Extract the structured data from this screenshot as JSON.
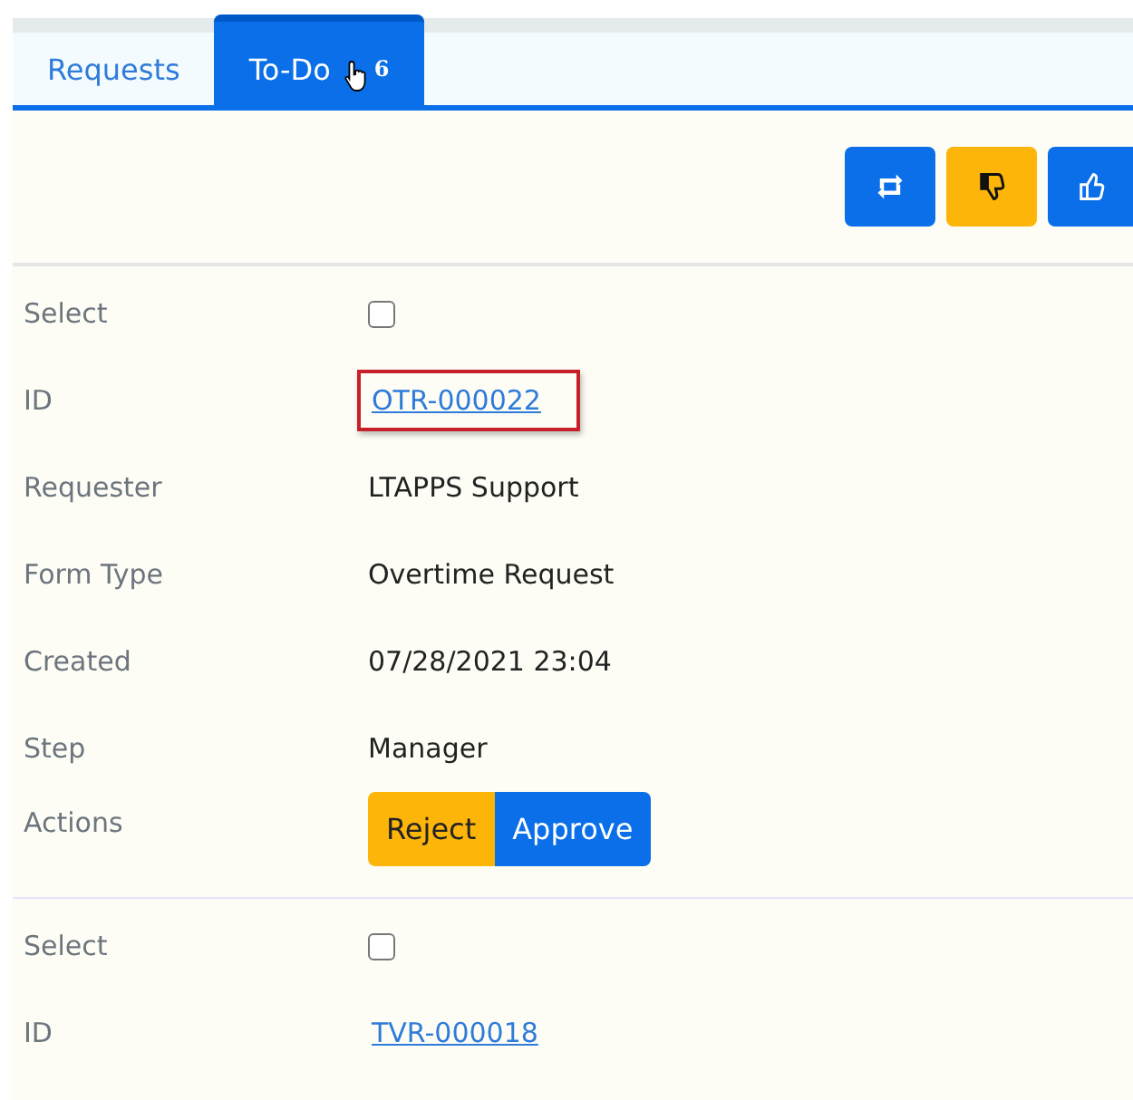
{
  "tabs": [
    {
      "label": "Requests",
      "selected": false
    },
    {
      "label": "To-Do",
      "badge": "6",
      "selected": true
    }
  ],
  "toolbar": [
    {
      "kind": "repeat",
      "color": "#0a6fe8"
    },
    {
      "kind": "dislike",
      "color": "#fdb50a"
    },
    {
      "kind": "like",
      "color": "#0a6fe8"
    }
  ],
  "records": [
    {
      "fields": [
        {
          "label": "Select",
          "kind": "checkbox",
          "checked": false
        },
        {
          "label": "ID",
          "kind": "link",
          "value": "OTR-000022",
          "highlighted": true
        },
        {
          "label": "Requester",
          "kind": "text",
          "value": "LTAPPS Support"
        },
        {
          "label": "Form Type",
          "kind": "text",
          "value": "Overtime Request"
        },
        {
          "label": "Created",
          "kind": "text",
          "value": "07/28/2021 23:04"
        },
        {
          "label": "Step",
          "kind": "text",
          "value": "Manager"
        },
        {
          "label": "Actions",
          "kind": "actions",
          "buttons": [
            {
              "label": "Reject",
              "color": "#fdb50a"
            },
            {
              "label": "Approve",
              "color": "#0a6fe8"
            }
          ]
        }
      ]
    },
    {
      "fields": [
        {
          "label": "Select",
          "kind": "checkbox",
          "checked": false
        },
        {
          "label": "ID",
          "kind": "link",
          "value": "TVR-000018",
          "highlighted": false
        }
      ]
    }
  ]
}
